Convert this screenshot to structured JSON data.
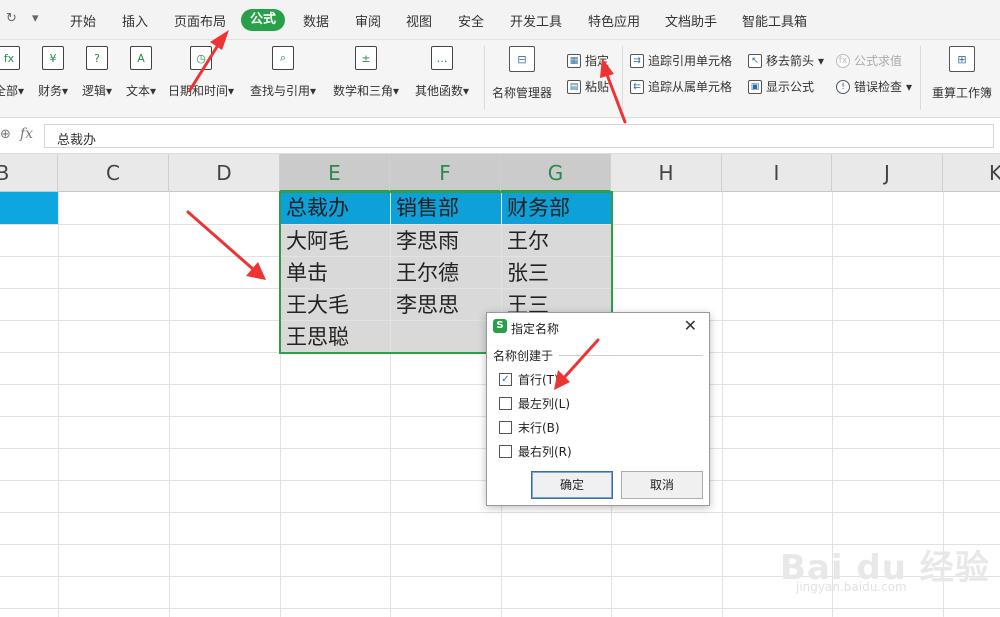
{
  "menubar": {
    "tabs": [
      "开始",
      "插入",
      "页面布局",
      "公式",
      "数据",
      "审阅",
      "视图",
      "安全",
      "开发工具",
      "特色应用",
      "文档助手",
      "智能工具箱"
    ],
    "active_tab": "公式",
    "accent": "#27a049"
  },
  "ribbon": {
    "function_groups": [
      "全部",
      "财务",
      "逻辑",
      "文本",
      "日期和时间",
      "查找与引用",
      "数学和三角",
      "其他函数"
    ],
    "name_manager": "名称管理器",
    "assign": "指定",
    "paste": "粘贴",
    "trace_precedents": "追踪引用单元格",
    "trace_dependents": "追踪从属单元格",
    "remove_arrows": "移去箭头",
    "show_formulas": "显示公式",
    "evaluate_formula": "公式求值",
    "error_checking": "错误检查",
    "recalc": "重算工作簿"
  },
  "formula_bar": {
    "fx": "fx",
    "value": "总裁办"
  },
  "columns": [
    "B",
    "C",
    "D",
    "E",
    "F",
    "G",
    "H",
    "I",
    "J",
    "K"
  ],
  "selected_columns": [
    "E",
    "F",
    "G"
  ],
  "table": {
    "header": [
      "总裁办",
      "销售部",
      "财务部"
    ],
    "rows": [
      [
        "大阿毛",
        "李思雨",
        "王尔"
      ],
      [
        "单击",
        "王尔德",
        "张三"
      ],
      [
        "王大毛",
        "李思思",
        "王三"
      ],
      [
        "王思聪",
        "",
        ""
      ]
    ]
  },
  "dialog": {
    "title": "指定名称",
    "group_label": "名称创建于",
    "options": [
      {
        "label": "首行(T)",
        "checked": true
      },
      {
        "label": "最左列(L)",
        "checked": false
      },
      {
        "label": "末行(B)",
        "checked": false
      },
      {
        "label": "最右列(R)",
        "checked": false
      }
    ],
    "ok": "确定",
    "cancel": "取消"
  },
  "watermark": {
    "text": "Bai du 经验",
    "url": "jingyan.baidu.com"
  },
  "colors": {
    "header_fill": "#0ea0d8",
    "body_fill": "#d9d9d9",
    "selection_border": "#2e9e48",
    "annotation_arrow": "#ee3333"
  }
}
